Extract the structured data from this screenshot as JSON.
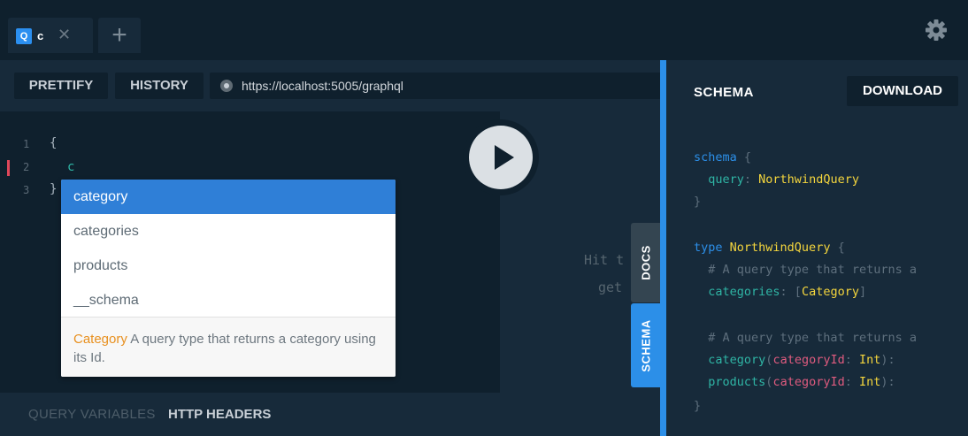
{
  "tabs": [
    {
      "badge": "Q",
      "name": "c",
      "close_icon": "close-icon"
    }
  ],
  "new_tab_label": "+",
  "settings_icon": "gear-icon",
  "toolbar": {
    "prettify_label": "PRETTIFY",
    "history_label": "HISTORY",
    "url": "https://localhost:5005/graphql"
  },
  "editor": {
    "line_numbers": [
      "1",
      "2",
      "3"
    ],
    "lines": [
      "{",
      "c",
      "}"
    ]
  },
  "autocomplete": {
    "items": [
      "category",
      "categories",
      "products",
      "__schema"
    ],
    "selected_index": 0,
    "info_type": "Category",
    "info_text": "A query type that returns a category using its Id."
  },
  "result_hint": {
    "line1": "Hit t",
    "line2": "get"
  },
  "side_tabs": {
    "docs": "DOCS",
    "schema": "SCHEMA"
  },
  "bottom": {
    "query_variables": "QUERY VARIABLES",
    "http_headers": "HTTP HEADERS"
  },
  "schema_panel": {
    "title": "SCHEMA",
    "download_label": "DOWNLOAD",
    "sdl": {
      "l1_kw": "schema",
      "l1_br": " {",
      "l2_field": "query",
      "l2_type": "NorthwindQuery",
      "l3": "}",
      "l5_kw": "type",
      "l5_type": "NorthwindQuery",
      "l5_br": " {",
      "l6": "# A query type that returns a",
      "l7_field": "categories",
      "l7_open": ": [",
      "l7_type": "Category",
      "l7_close": "]",
      "l9": "# A query type that returns a",
      "l10_field": "category",
      "l10_arg": "categoryId",
      "l10_type": "Int",
      "l11_field": "products",
      "l11_arg": "categoryId",
      "l11_type": "Int",
      "l12": "}"
    }
  },
  "colors": {
    "accent": "#2c8fe8",
    "selection": "#2f7fd7",
    "type_highlight": "#f5d63d",
    "error": "#e0475a"
  }
}
